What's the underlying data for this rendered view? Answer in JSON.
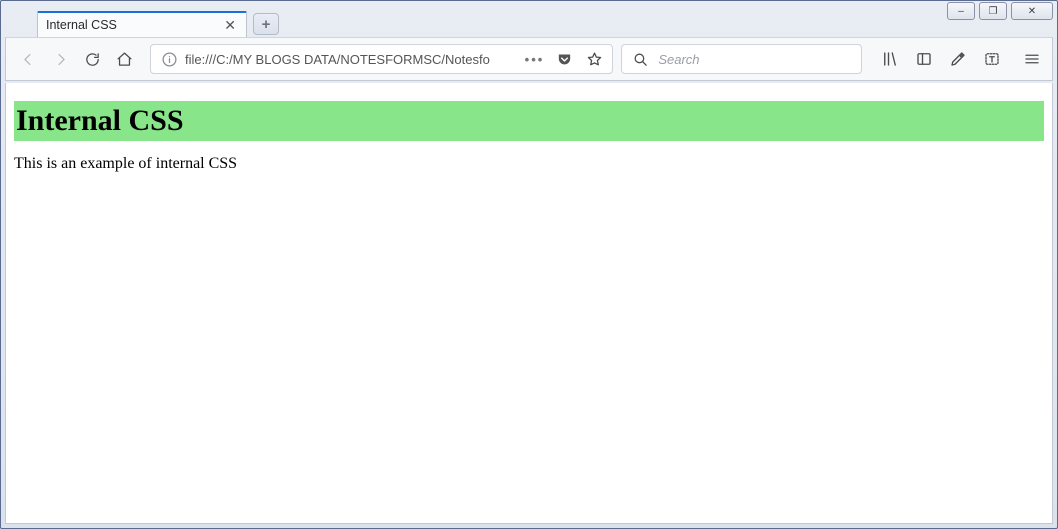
{
  "window": {
    "controls": {
      "min": "–",
      "max": "❐",
      "close": "✕"
    }
  },
  "tab": {
    "title": "Internal CSS"
  },
  "nav": {
    "back_label": "back",
    "forward_label": "forward",
    "reload_label": "reload",
    "home_label": "home"
  },
  "urlbar": {
    "url": "file:///C:/MY BLOGS DATA/NOTESFORMSC/Notesfo",
    "dots": "•••"
  },
  "searchbar": {
    "placeholder": "Search"
  },
  "page": {
    "heading": "Internal CSS",
    "heading_bg": "#89e589",
    "paragraph": "This is an example of internal CSS"
  }
}
